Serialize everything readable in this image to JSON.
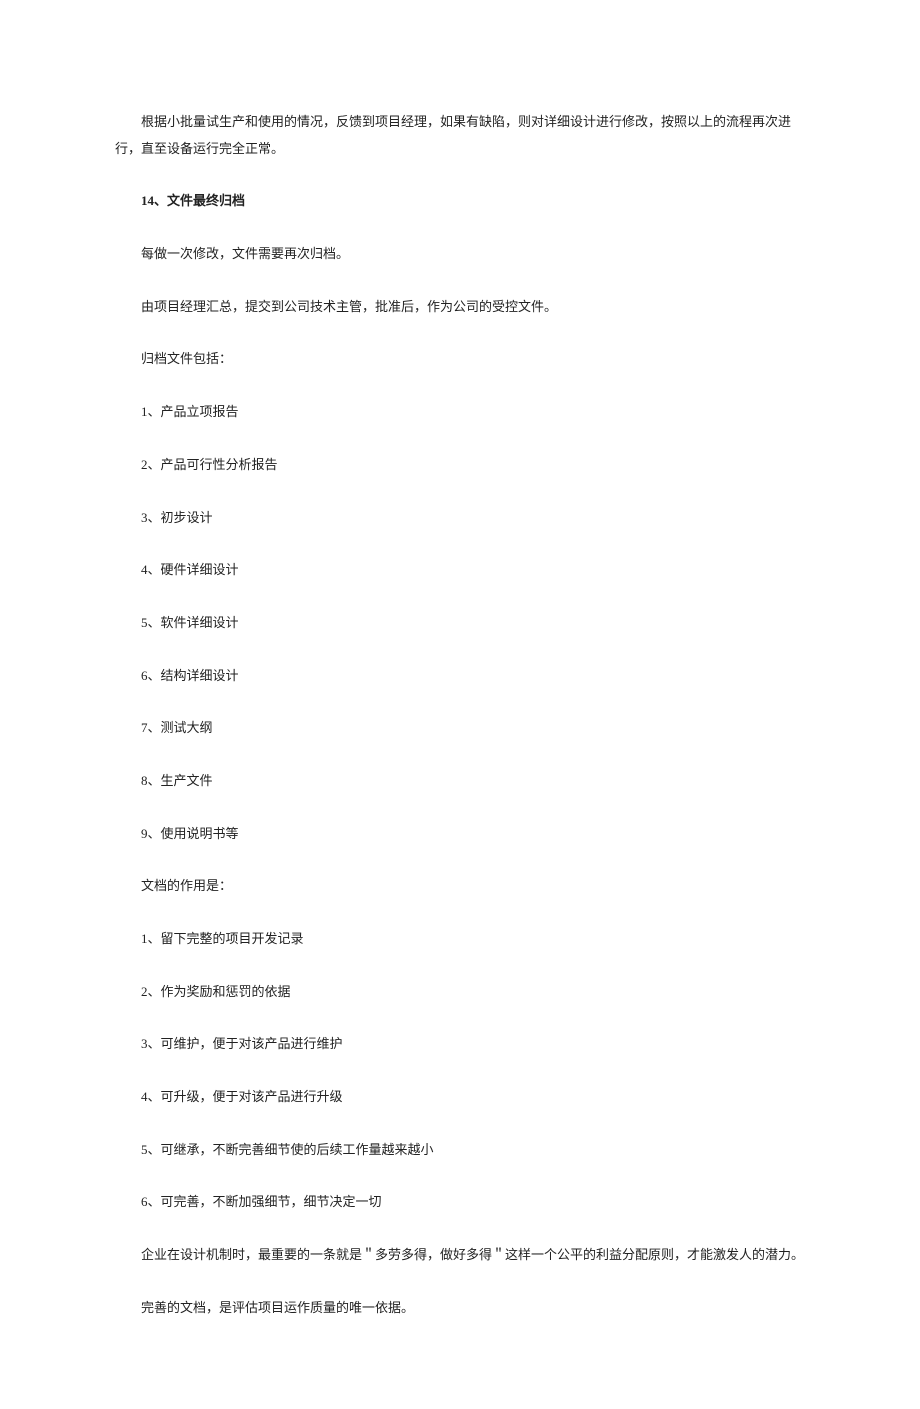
{
  "intro_para_line1": "根据小批量试生产和使用的情况，反馈到项目经理，如果有缺陷，则对详细设计进行修改，按照以上的流程再次进",
  "intro_para_line2": "行，直至设备运行完全正常。",
  "section_heading": "14、文件最终归档",
  "para1": "每做一次修改，文件需要再次归档。",
  "para2": "由项目经理汇总，提交到公司技术主管，批准后，作为公司的受控文件。",
  "para3": "归档文件包括：",
  "archive_items": [
    "1、产品立项报告",
    "2、产品可行性分析报告",
    "3、初步设计",
    "4、硬件详细设计",
    "5、软件详细设计",
    "6、结构详细设计",
    "7、测试大纲",
    "8、生产文件",
    "9、使用说明书等"
  ],
  "para4": "文档的作用是：",
  "purpose_items": [
    "1、留下完整的项目开发记录",
    "2、作为奖励和惩罚的依据",
    "3、可维护，便于对该产品进行维护",
    "4、可升级，便于对该产品进行升级",
    "5、可继承，不断完善细节使的后续工作量越来越小",
    "6、可完善，不断加强细节，细节决定一切"
  ],
  "para5": "企业在设计机制时，最重要的一条就是＂多劳多得，做好多得＂这样一个公平的利益分配原则，才能激发人的潜力。",
  "para6": "完善的文档，是评估项目运作质量的唯一依据。"
}
